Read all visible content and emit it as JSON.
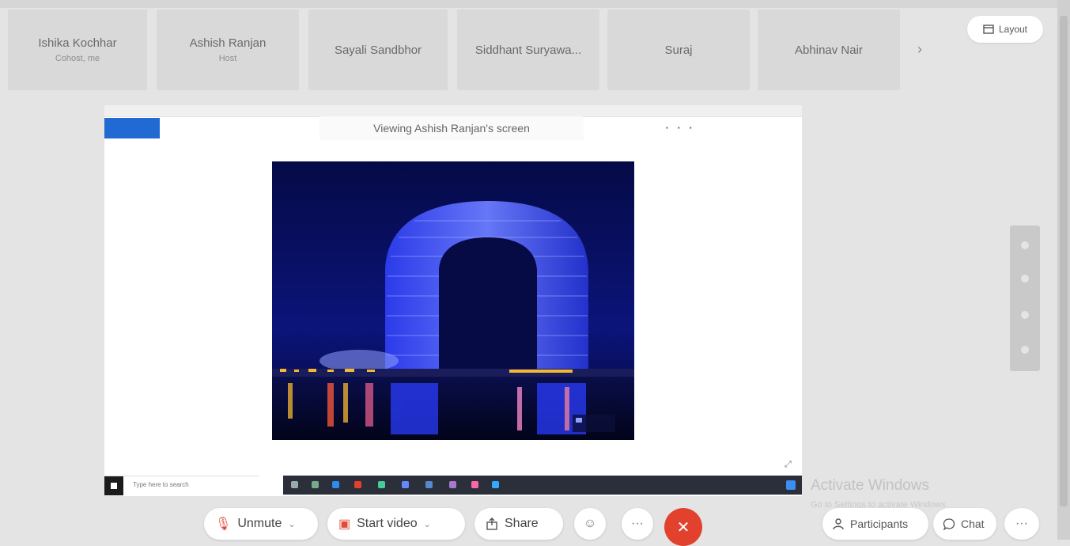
{
  "participants": [
    {
      "name": "Ishika Kochhar",
      "sub": "Cohost, me"
    },
    {
      "name": "Ashish Ranjan",
      "sub": "Host"
    },
    {
      "name": "Sayali Sandbhor",
      "sub": ""
    },
    {
      "name": "Siddhant Suryawa...",
      "sub": ""
    },
    {
      "name": "Suraj",
      "sub": ""
    },
    {
      "name": "Abhinav Nair",
      "sub": ""
    }
  ],
  "next_icon": "chevron-right",
  "layout": {
    "label": "Layout",
    "icon": "window-icon"
  },
  "share": {
    "viewing_label": "Viewing Ashish Ranjan's screen",
    "photo_subject": "blue-lit horseshoe hotel at night",
    "taskbar_search": "Type here to search"
  },
  "watermark": {
    "title": "Activate Windows",
    "subtitle": "Go to Settings to activate Windows."
  },
  "controls": {
    "unmute": "Unmute",
    "start_video": "Start video",
    "share": "Share",
    "reactions_icon": "smiley-icon",
    "more_label": "···",
    "end_icon": "close-icon"
  },
  "right_controls": {
    "participants": "Participants",
    "chat": "Chat",
    "more": "···"
  },
  "colors": {
    "accent_blue": "#2169d3",
    "end_call_red": "#e2412e",
    "unmute_red": "#e04b3c"
  }
}
